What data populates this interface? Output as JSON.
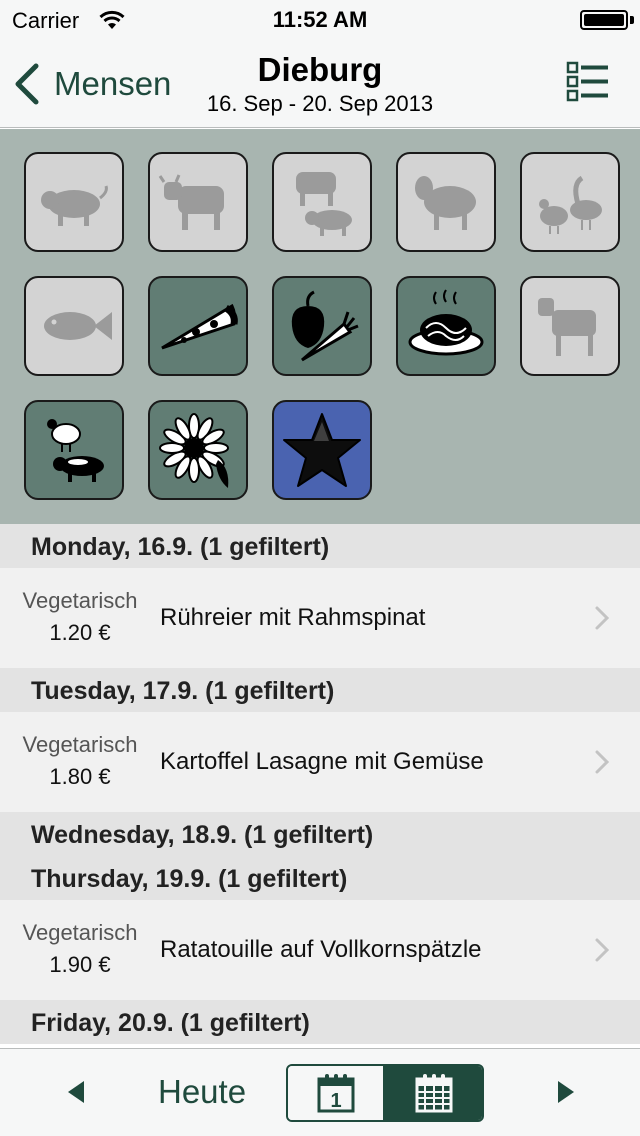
{
  "status_bar": {
    "carrier": "Carrier",
    "time": "11:52 AM"
  },
  "nav": {
    "back_label": "Mensen",
    "title": "Dieburg",
    "subtitle": "16. Sep - 20. Sep 2013"
  },
  "filters": [
    {
      "name": "pork",
      "icon": "pig-icon",
      "active": false
    },
    {
      "name": "beef",
      "icon": "cow-icon",
      "active": false
    },
    {
      "name": "mixed-meat",
      "icon": "cow-pig-icon",
      "active": false
    },
    {
      "name": "lamb",
      "icon": "sheep-icon",
      "active": false
    },
    {
      "name": "poultry",
      "icon": "chicken-goose-icon",
      "active": false
    },
    {
      "name": "fish",
      "icon": "fish-icon",
      "active": false
    },
    {
      "name": "pizza",
      "icon": "pizza-icon",
      "active": true
    },
    {
      "name": "vegetarian",
      "icon": "vegetables-icon",
      "active": true
    },
    {
      "name": "pasta",
      "icon": "pasta-icon",
      "active": true
    },
    {
      "name": "veal",
      "icon": "calf-icon",
      "active": false
    },
    {
      "name": "chicken-pork",
      "icon": "chicken-pig-icon",
      "active": true
    },
    {
      "name": "vegan",
      "icon": "flower-icon",
      "active": true
    },
    {
      "name": "favorites",
      "icon": "star-icon",
      "active": true
    }
  ],
  "days": [
    {
      "header": "Monday, 16.9. (1 gefiltert)",
      "meals": [
        {
          "category": "Vegetarisch",
          "price": "1.20 €",
          "name": "Rühreier mit Rahmspinat"
        }
      ]
    },
    {
      "header": "Tuesday, 17.9. (1 gefiltert)",
      "meals": [
        {
          "category": "Vegetarisch",
          "price": "1.80 €",
          "name": "Kartoffel Lasagne mit Gemüse"
        }
      ]
    },
    {
      "header": "Wednesday, 18.9. (1 gefiltert)",
      "meals": []
    },
    {
      "header": "Thursday, 19.9. (1 gefiltert)",
      "meals": [
        {
          "category": "Vegetarisch",
          "price": "1.90 €",
          "name": "Ratatouille auf Vollkornspätzle"
        }
      ]
    },
    {
      "header": "Friday, 20.9. (1 gefiltert)",
      "meals": []
    }
  ],
  "toolbar": {
    "today_label": "Heute",
    "day_icon_number": "1",
    "selected_view": "week"
  },
  "colors": {
    "accent": "#1f4a3d",
    "filter_panel": "#a8b5b0",
    "filter_on": "#617d74",
    "filter_off": "#d3d3d3",
    "favorites": "#4a63b0"
  }
}
